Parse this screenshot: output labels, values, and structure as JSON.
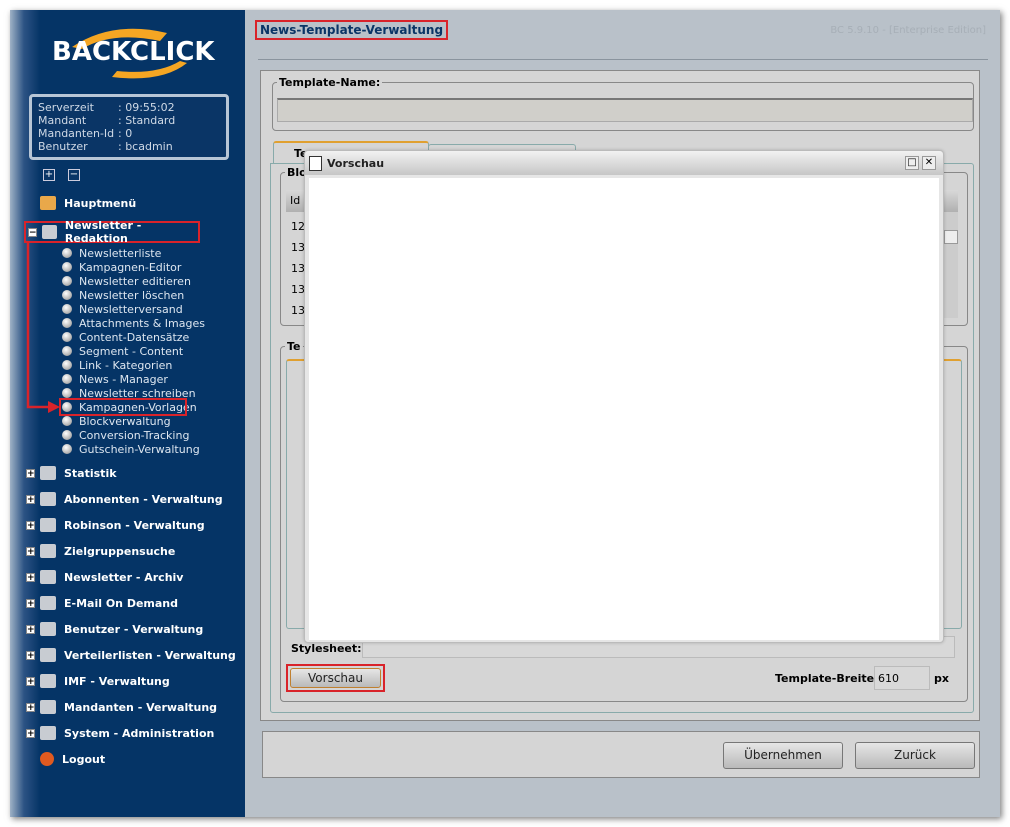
{
  "sidebar": {
    "logo": "BACKCLICK",
    "info": [
      {
        "k": "Serverzeit",
        "v": ": 09:55:02"
      },
      {
        "k": "Mandant",
        "v": ": Standard"
      },
      {
        "k": "Mandanten-Id",
        "v": ": 0"
      },
      {
        "k": "Benutzer",
        "v": ": bcadmin"
      }
    ],
    "expand": "+",
    "collapse": "−",
    "home": "Hauptmenü",
    "active_group": "Newsletter - Redaktion",
    "sub_items": [
      "Newsletterliste",
      "Kampagnen-Editor",
      "Newsletter editieren",
      "Newsletter löschen",
      "Newsletterversand",
      "Attachments & Images",
      "Content-Datensätze",
      "Segment - Content",
      "Link - Kategorien",
      "News - Manager",
      "Newsletter schreiben",
      "Kampagnen-Vorlagen",
      "Blockverwaltung",
      "Conversion-Tracking",
      "Gutschein-Verwaltung"
    ],
    "groups": [
      "Statistik",
      "Abonnenten - Verwaltung",
      "Robinson - Verwaltung",
      "Zielgruppensuche",
      "Newsletter - Archiv",
      "E-Mail On Demand",
      "Benutzer - Verwaltung",
      "Verteilerlisten - Verwaltung",
      "IMF - Verwaltung",
      "Mandanten - Verwaltung",
      "System - Administration"
    ],
    "logout": "Logout"
  },
  "header": {
    "title": "News-Template-Verwaltung",
    "version": "BC 5.9.10 - [Enterprise Edition]"
  },
  "form": {
    "template_name_label": "Template-Name:",
    "template_name_value": "",
    "tab1": "Te",
    "block_legend": "Blo",
    "table_header": "Id",
    "rows": [
      "12",
      "13",
      "13",
      "13",
      "13"
    ],
    "te_legend": "Te",
    "stylesheet_label": "Stylesheet:",
    "preview_button": "Vorschau",
    "width_label": "Template-Breite:",
    "width_value": "610",
    "width_unit": "px"
  },
  "footer": {
    "apply": "Übernehmen",
    "back": "Zurück"
  },
  "dialog": {
    "title": "Vorschau",
    "maximize": "□",
    "close": "✕"
  },
  "colors": {
    "sidebar": "#053466",
    "highlight": "#d9232a",
    "accent": "#f5a623"
  }
}
